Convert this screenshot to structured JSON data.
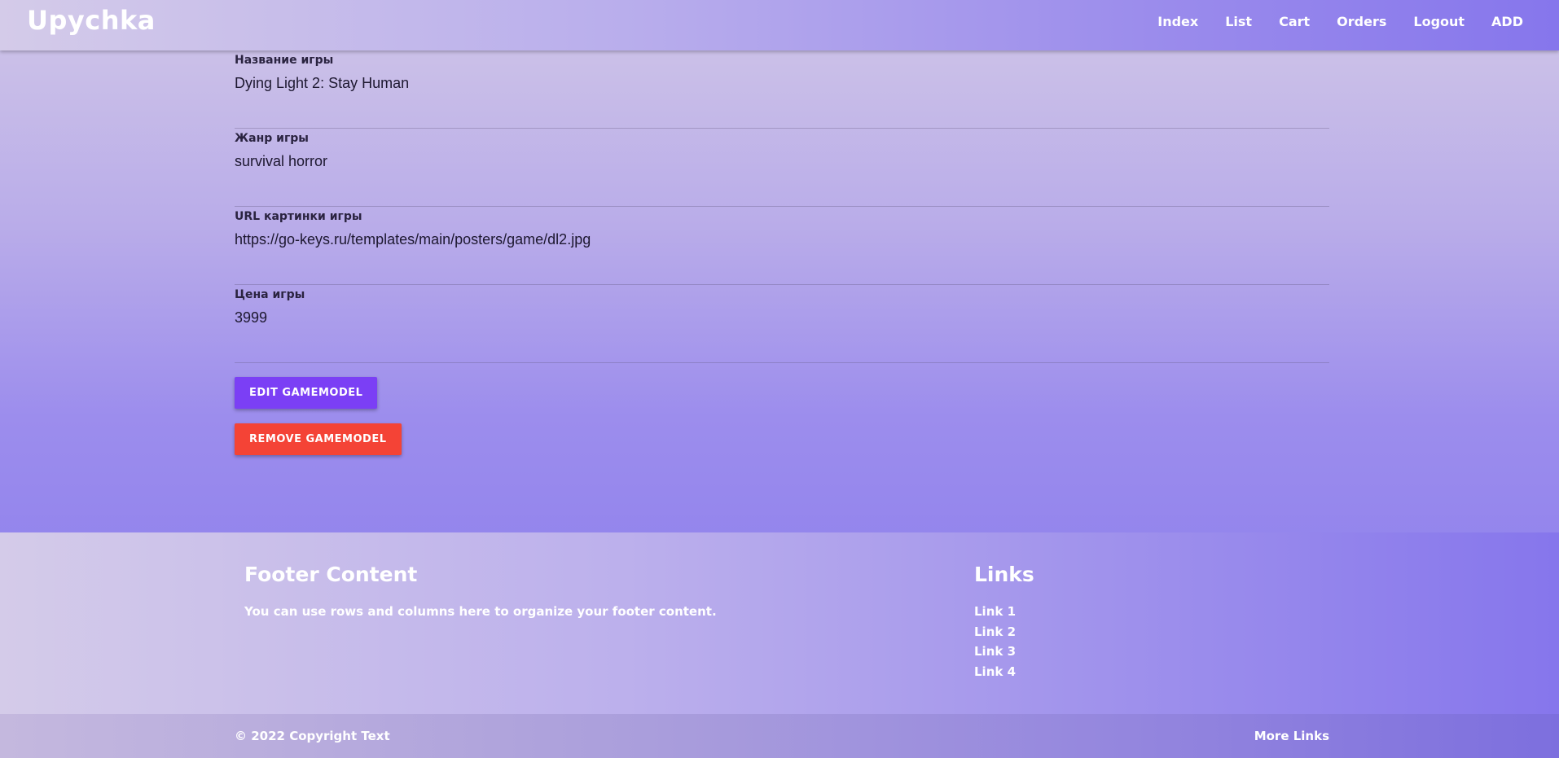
{
  "navbar": {
    "brand": "Upychka",
    "links": [
      "Index",
      "List",
      "Cart",
      "Orders",
      "Logout",
      "ADD"
    ]
  },
  "fields": [
    {
      "label": "Название игры",
      "value": "Dying Light 2: Stay Human"
    },
    {
      "label": "Жанр игры",
      "value": "survival horror"
    },
    {
      "label": "URL картинки игры",
      "value": "https://go-keys.ru/templates/main/posters/game/dl2.jpg"
    },
    {
      "label": "Цена игры",
      "value": "3999"
    }
  ],
  "actions": {
    "edit_label": "EDIT GAMEMODEL",
    "remove_label": "REMOVE GAMEMODEL"
  },
  "footer": {
    "title": "Footer Content",
    "text": "You can use rows and columns here to organize your footer content.",
    "links_title": "Links",
    "links": [
      "Link 1",
      "Link 2",
      "Link 3",
      "Link 4"
    ],
    "copyright": "© 2022 Copyright Text",
    "more_links": "More Links"
  },
  "colors": {
    "edit_button": "#7b3ff5",
    "remove_button": "#f44336",
    "accent": "#8676ec"
  }
}
